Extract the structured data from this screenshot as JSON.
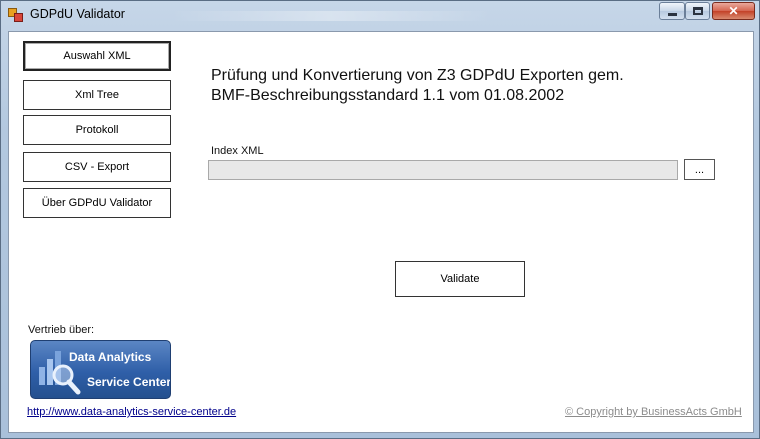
{
  "window": {
    "title": "GDPdU Validator"
  },
  "nav": {
    "items": [
      {
        "label": "Auswahl XML",
        "active": true
      },
      {
        "label": "Xml Tree"
      },
      {
        "label": "Protokoll"
      },
      {
        "label": "CSV - Export"
      },
      {
        "label": "Über GDPdU Validator"
      }
    ]
  },
  "main": {
    "headline_line1": "Prüfung und Konvertierung von Z3 GDPdU Exporten gem.",
    "headline_line2": "BMF-Beschreibungsstandard  1.1 vom 01.08.2002",
    "index_label": "Index XML",
    "index_value": "",
    "browse_label": "...",
    "validate_label": "Validate"
  },
  "footer": {
    "vertrieb_label": "Vertrieb über:",
    "logo_line1": "Data Analytics",
    "logo_line2": "Service Center",
    "url": "http://www.data-analytics-service-center.de",
    "copyright": "© Copyright by BusinessActs GmbH"
  },
  "icons": {
    "app": "app-icon",
    "minimize": "minimize-icon",
    "maximize": "maximize-icon",
    "close": "close-icon",
    "logo_graphic": "magnifier-chart-icon"
  }
}
